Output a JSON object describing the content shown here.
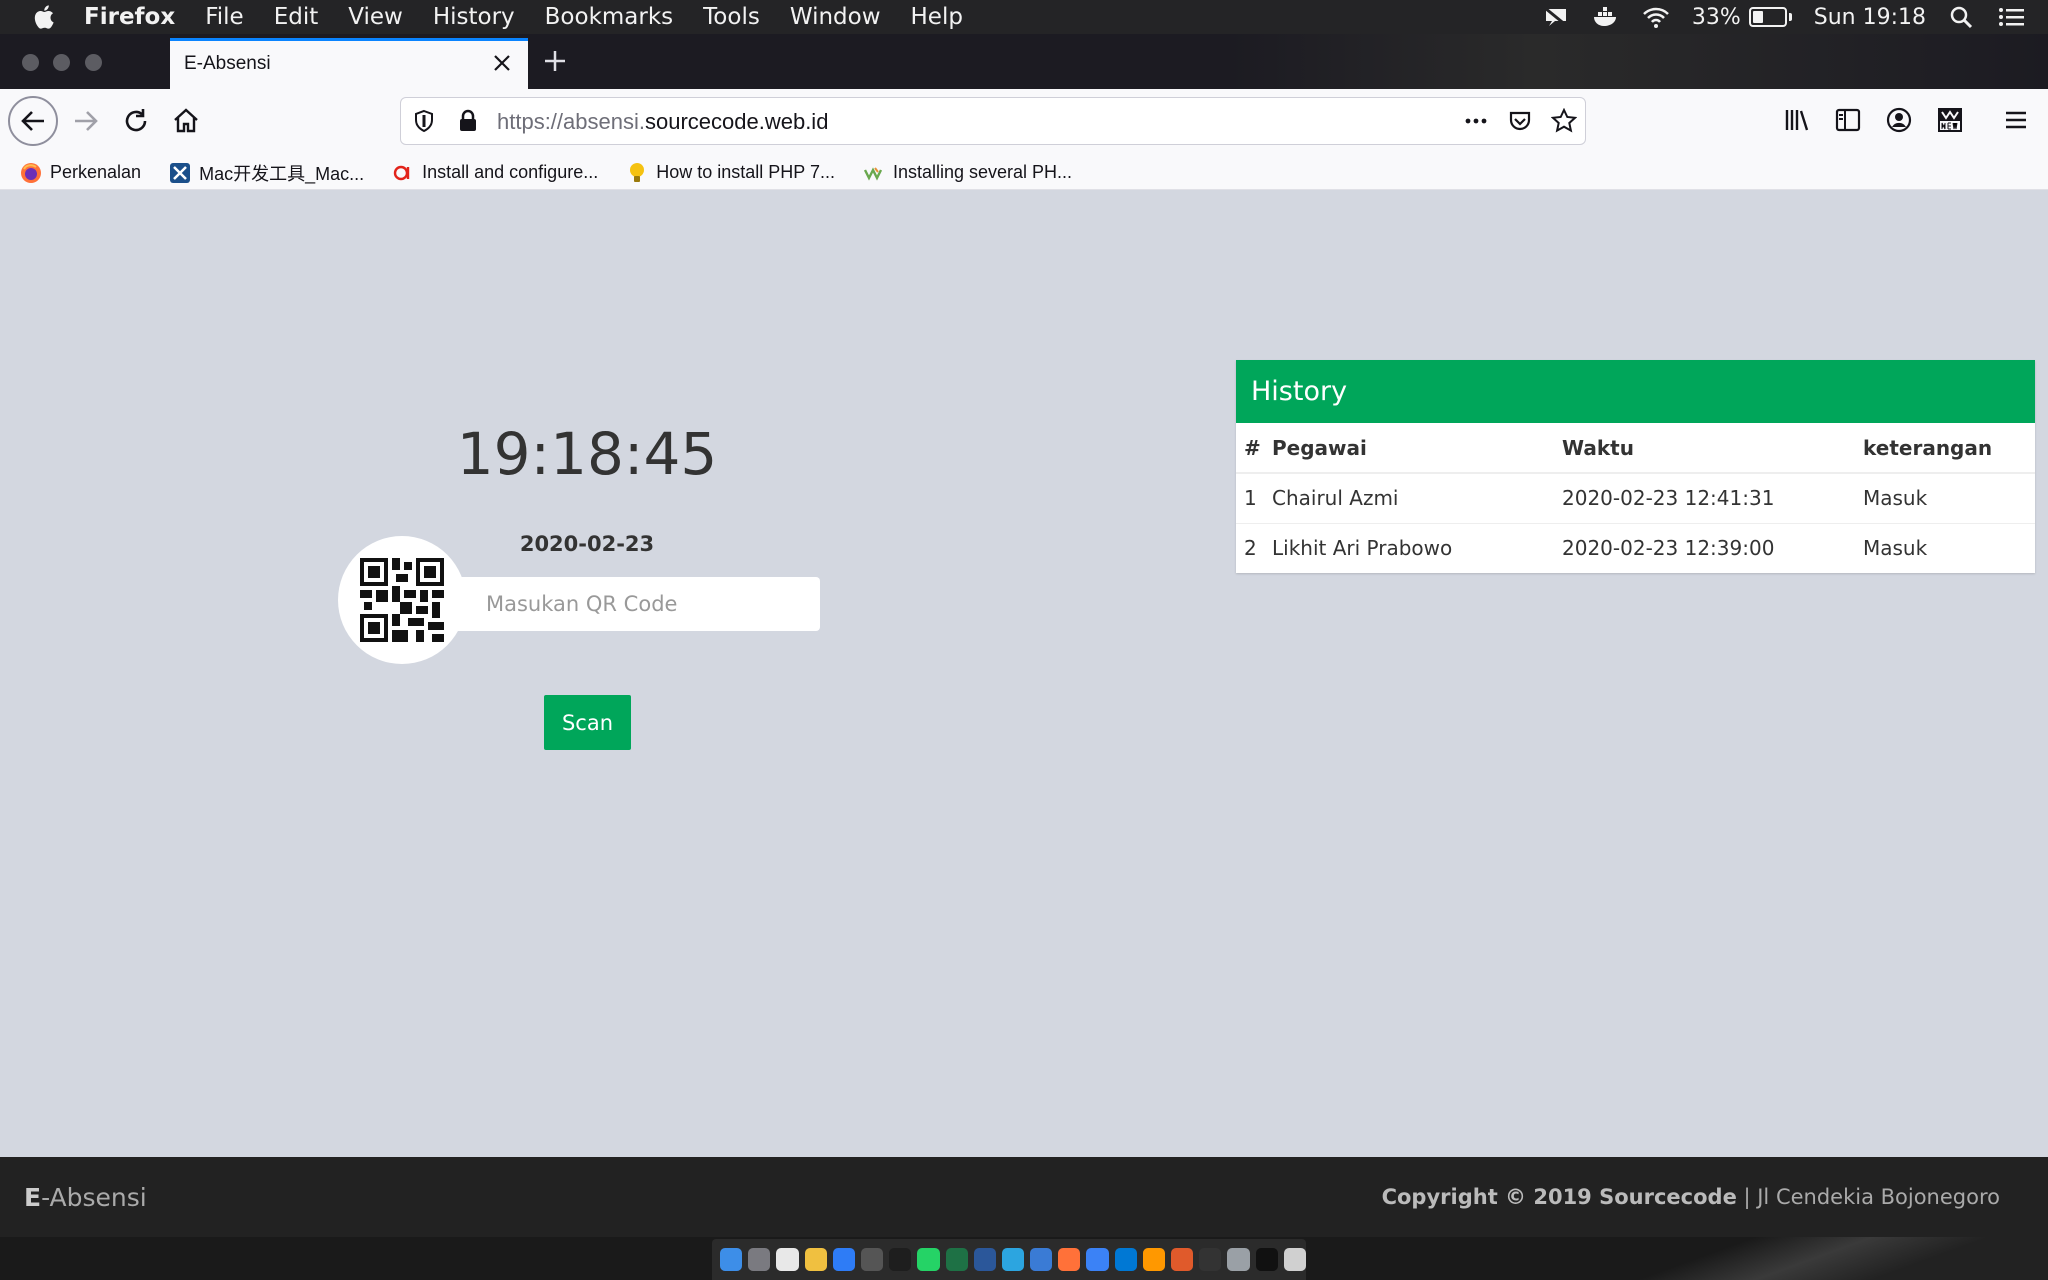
{
  "menubar": {
    "app_name": "Firefox",
    "items": [
      "File",
      "Edit",
      "View",
      "History",
      "Bookmarks",
      "Tools",
      "Window",
      "Help"
    ],
    "battery_percent": "33%",
    "battery_level": 0.33,
    "clock": "Sun 19:18"
  },
  "tab": {
    "title": "E-Absensi"
  },
  "urlbar": {
    "url_dim": "https://absensi.",
    "url_host": "sourcecode.web.id"
  },
  "bookmarks": [
    {
      "label": "Perkenalan",
      "icon": "firefox-icon"
    },
    {
      "label": "Mac开发工具_Mac...",
      "icon": "app-icon"
    },
    {
      "label": "Install and configure...",
      "icon": "ql-icon"
    },
    {
      "label": "How to install PHP 7...",
      "icon": "lightbulb-icon"
    },
    {
      "label": "Installing several PH...",
      "icon": "wavy-icon"
    }
  ],
  "page": {
    "clock": "19:18:45",
    "date": "2020-02-23",
    "qr_placeholder": "Masukan QR Code",
    "scan_label": "Scan"
  },
  "history": {
    "title": "History",
    "columns": [
      "#",
      "Pegawai",
      "Waktu",
      "keterangan"
    ],
    "rows": [
      {
        "num": "1",
        "pegawai": "Chairul Azmi",
        "waktu": "2020-02-23 12:41:31",
        "keterangan": "Masuk"
      },
      {
        "num": "2",
        "pegawai": "Likhit Ari Prabowo",
        "waktu": "2020-02-23 12:39:00",
        "keterangan": "Masuk"
      }
    ]
  },
  "footer": {
    "brand_bold": "E",
    "brand_rest": "-Absensi",
    "copyright_bold": "Copyright © 2019 Sourcecode",
    "copyright_rest": " | Jl Cendekia Bojonegoro"
  },
  "colors": {
    "accent_green": "#00a65a",
    "page_bg": "#d3d7e0",
    "footer_bg": "#222222"
  }
}
